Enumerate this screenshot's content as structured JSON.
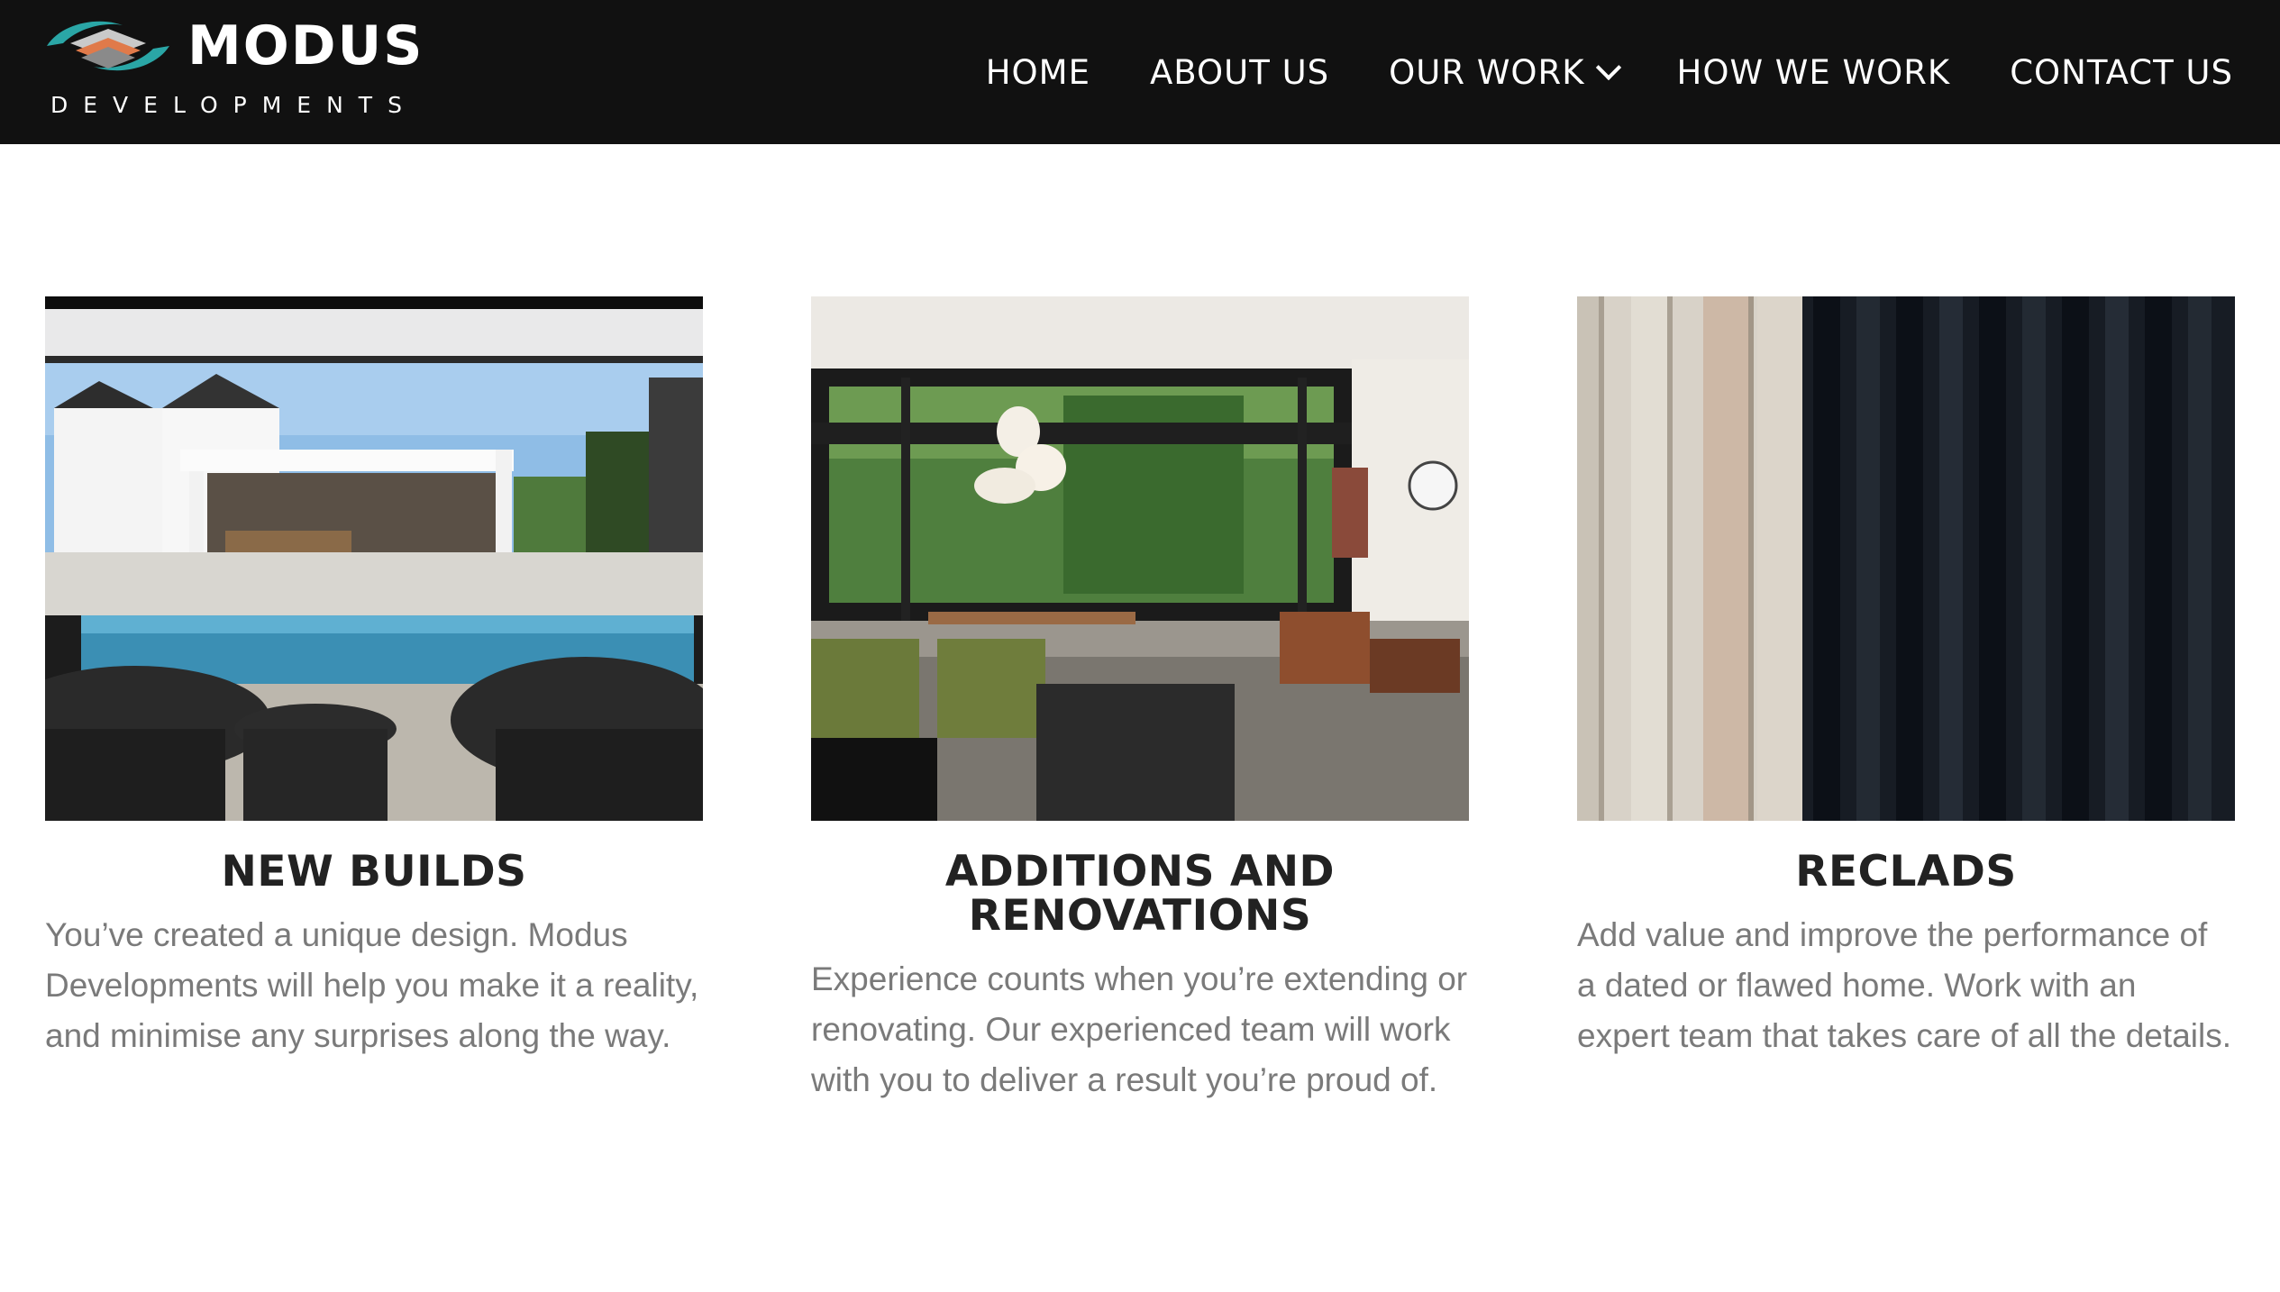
{
  "header": {
    "logo_word": "MODUS",
    "logo_sub": "DEVELOPMENTS",
    "nav": [
      {
        "label": "HOME"
      },
      {
        "label": "ABOUT US"
      },
      {
        "label": "OUR WORK"
      },
      {
        "label": "HOW WE WORK"
      },
      {
        "label": "CONTACT US"
      }
    ]
  },
  "cards": [
    {
      "title": "NEW BUILDS",
      "text": "You’ve created a unique design. Modus Developments will help you make it a reality, and minimise any surprises along the way."
    },
    {
      "title": "ADDITIONS AND RENOVATIONS",
      "text": "Experience counts when you’re extending or renovating. Our experienced team will work with you to deliver a result you’re proud of."
    },
    {
      "title": "RECLADS",
      "text": "Add value and improve the performance of a dated or flawed home. Work with an expert team that takes care of all the details."
    }
  ],
  "colors": {
    "header_bg": "#111111",
    "logo_teal": "#2aa6a6",
    "logo_orange": "#e07a4a",
    "heading": "#222222",
    "body_text": "#7a7a7a"
  },
  "icons": {
    "logo": "stacked-layers-logo-icon",
    "dropdown": "chevron-down-icon"
  }
}
